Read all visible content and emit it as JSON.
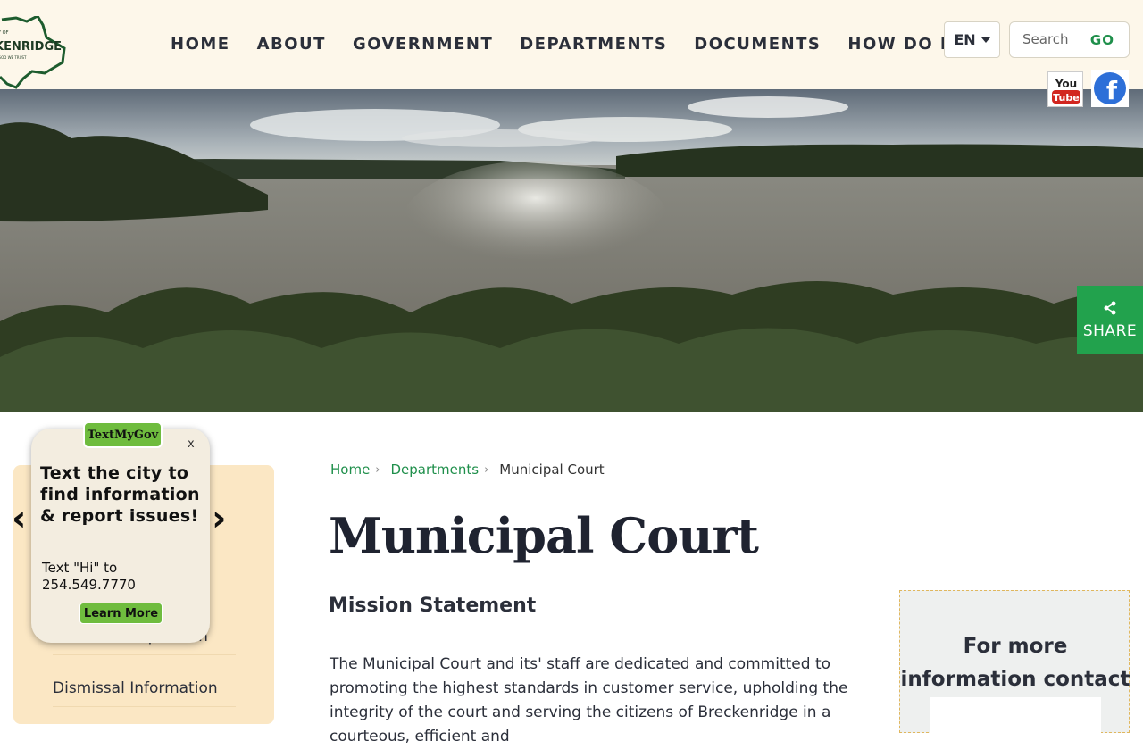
{
  "header": {
    "logo_alt": "City of Breckenridge - In God We Trust",
    "logo_text": "KENRIDGE",
    "nav": [
      "HOME",
      "ABOUT",
      "GOVERNMENT",
      "DEPARTMENTS",
      "DOCUMENTS",
      "HOW DO I"
    ],
    "language": "EN",
    "search_placeholder": "Search",
    "search_button": "GO",
    "social": [
      "youtube-icon",
      "facebook-icon"
    ],
    "youtube_you": "You",
    "youtube_tube": "Tube"
  },
  "share": {
    "label": "SHARE"
  },
  "textmygov": {
    "badge": "TextMyGov",
    "close": "x",
    "headline": "Text the city to find information & report issues!",
    "body": "Text \"Hi\" to 254.549.7770",
    "cta": "Learn More"
  },
  "sidebar": {
    "items": [
      "Deferred Disposition",
      "Dismissal Information"
    ]
  },
  "breadcrumb": {
    "items": [
      "Home",
      "Departments"
    ],
    "current": "Municipal Court"
  },
  "main": {
    "title": "Municipal Court",
    "section_heading": "Mission Statement",
    "paragraph": "The Municipal Court and its' staff are dedicated and committed to promoting the highest standards in customer service, upholding the integrity of the court and serving the citizens of Breckenridge in a courteous, efficient and"
  },
  "info_box": {
    "title": "For more information contact us"
  },
  "colors": {
    "accent_green": "#22a24d",
    "header_bg": "#fdf7ea",
    "sidebar_bg": "#fbe7c4"
  }
}
